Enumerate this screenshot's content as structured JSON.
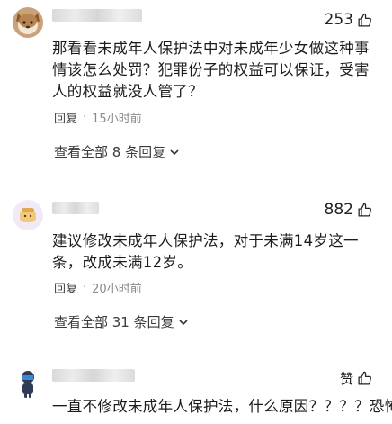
{
  "comments": [
    {
      "likes": "253",
      "text": "那看看未成年人保护法中对未成年少女做这种事情该怎么处罚？犯罪份子的权益可以保证，受害人的权益就没人管了？",
      "reply_label": "回复",
      "time": "15小时前",
      "view_replies": "查看全部 8 条回复"
    },
    {
      "likes": "882",
      "text": "建议修改未成年人保护法，对于未满14岁这一条，改成未满12岁。",
      "reply_label": "回复",
      "time": "20小时前",
      "view_replies": "查看全部 31 条回复"
    },
    {
      "likes": "赞",
      "text": "一直不修改未成年人保护法，什么原因？？？？恐怖"
    }
  ],
  "colors": {
    "text": "#1b1b1b",
    "meta": "#8a8a8a",
    "background": "#ffffff"
  },
  "icons": [
    "thumbs-up-icon",
    "chevron-down-icon"
  ]
}
